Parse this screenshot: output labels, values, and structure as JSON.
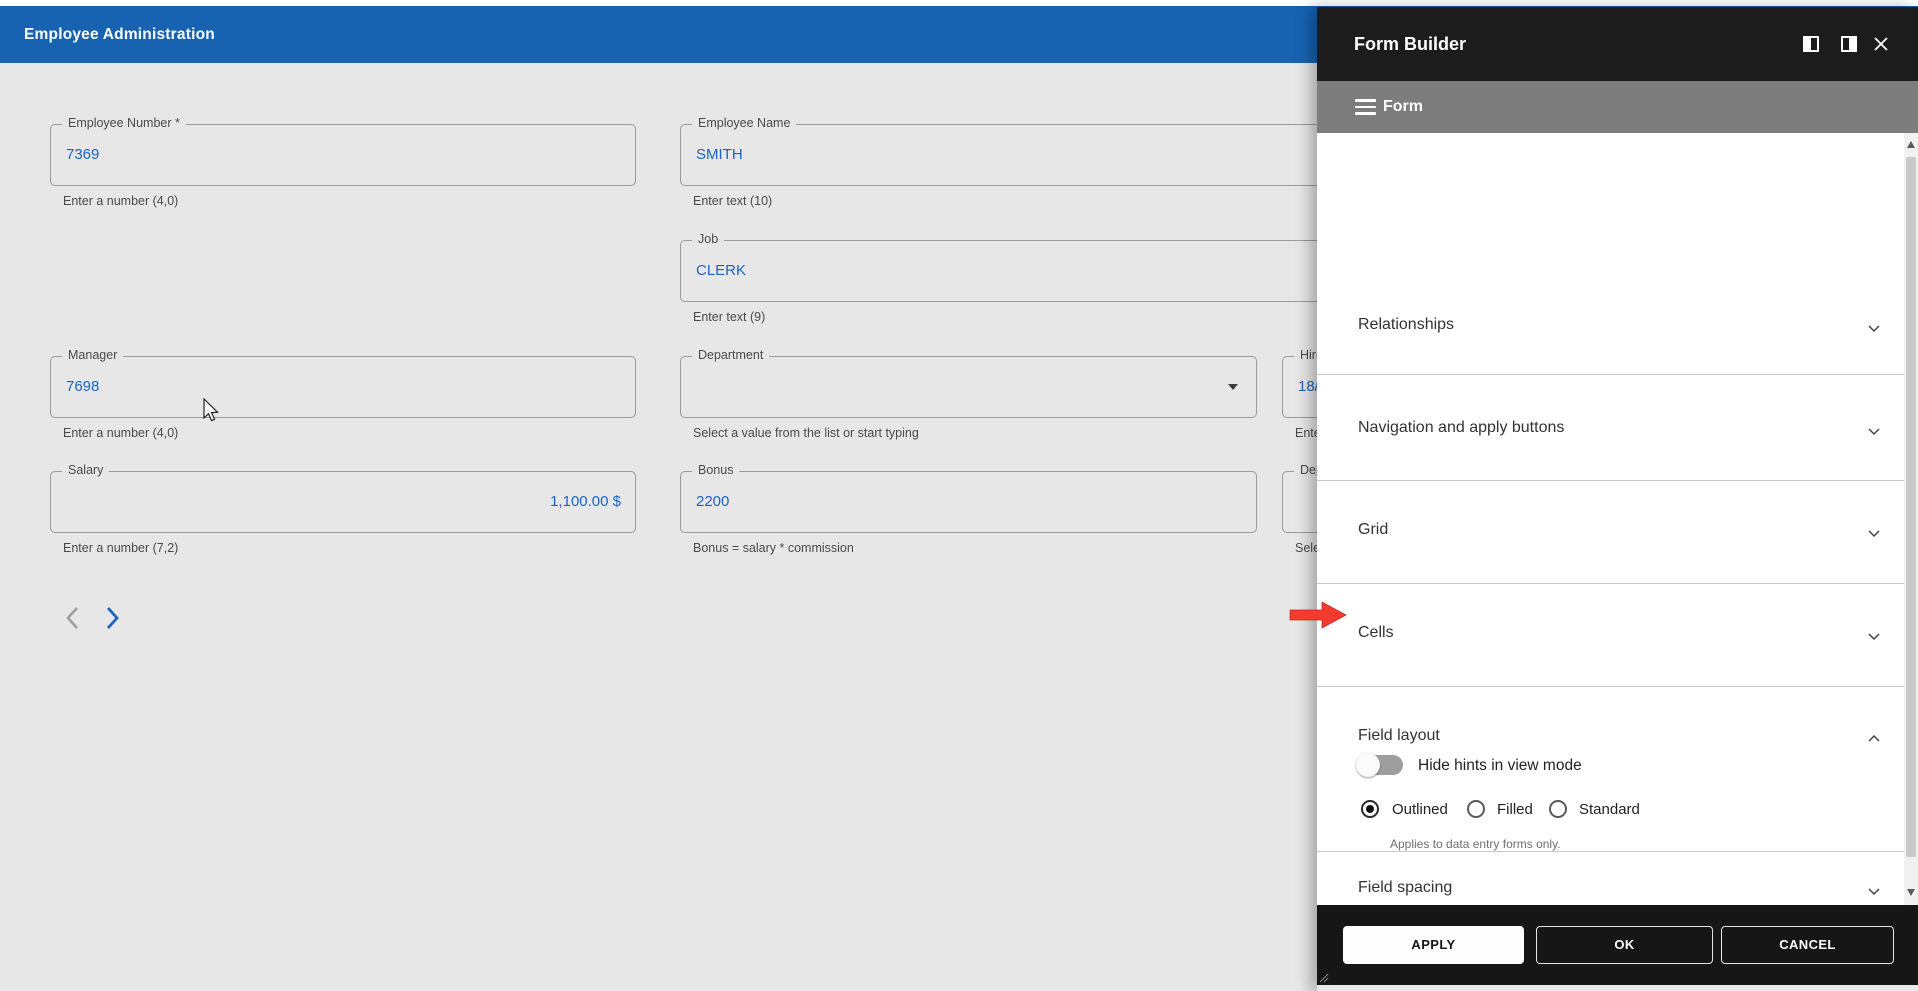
{
  "app": {
    "title": "Employee Administration"
  },
  "colors": {
    "header_blue": "#1763b2",
    "value_blue": "#1b63c1",
    "panel_dark": "#1c1c1c",
    "panel_gray": "#7d7d7d",
    "annotation_red": "#f23b2e"
  },
  "form": {
    "fields": {
      "emp_no": {
        "label": "Employee Number *",
        "value": "7369",
        "hint": "Enter a number (4,0)"
      },
      "emp_name": {
        "label": "Employee Name",
        "value": "SMITH",
        "hint": "Enter text (10)"
      },
      "job": {
        "label": "Job",
        "value": "CLERK",
        "hint": "Enter text (9)"
      },
      "manager": {
        "label": "Manager",
        "value": "7698",
        "hint": "Enter a number (4,0)"
      },
      "department": {
        "label": "Department",
        "value": "",
        "hint": "Select a value from the list or start typing"
      },
      "hire_date": {
        "label": "Hire",
        "value": "18/",
        "hint": "Ente"
      },
      "salary": {
        "label": "Salary",
        "value": "1,100.00 $",
        "hint": "Enter a number (7,2)"
      },
      "bonus": {
        "label": "Bonus",
        "value": "2200",
        "hint": "Bonus = salary * commission"
      },
      "dept2": {
        "label": "Dep",
        "value": "",
        "hint": "Sele"
      }
    }
  },
  "panel": {
    "title": "Form Builder",
    "menu_label": "Form",
    "sections": [
      {
        "label": "Relationships"
      },
      {
        "label": "Navigation and apply buttons"
      },
      {
        "label": "Grid"
      },
      {
        "label": "Cells"
      }
    ],
    "field_layout": {
      "label": "Field layout",
      "options": [
        "Outlined",
        "Filled",
        "Standard"
      ],
      "selected": "Outlined",
      "hint": "Applies to data entry forms only.",
      "toggle_label": "Hide hints in view mode",
      "toggle_on": false
    },
    "field_spacing": {
      "label": "Field spacing"
    },
    "buttons": {
      "apply": "APPLY",
      "ok": "OK",
      "cancel": "CANCEL"
    }
  }
}
